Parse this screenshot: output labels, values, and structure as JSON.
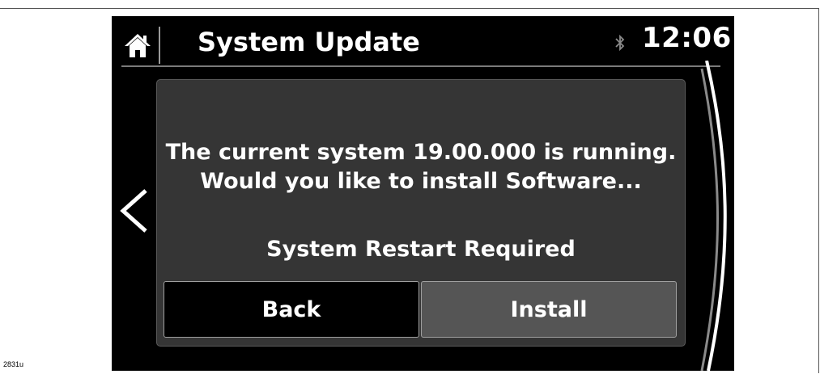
{
  "header": {
    "title": "System Update",
    "clock": "12:06",
    "home_icon": "home-icon",
    "status_icon": "bluetooth-icon"
  },
  "navigation": {
    "back_icon": "chevron-left-icon"
  },
  "dialog": {
    "message_line1": "The current system 19.00.000 is running.",
    "message_line2": "Would you like to install Software...",
    "note": "System Restart Required",
    "buttons": {
      "back_label": "Back",
      "install_label": "Install"
    }
  },
  "figure_code": "2831u",
  "colors": {
    "screen_bg": "#000000",
    "dialog_bg": "#353535",
    "install_button_bg": "#555555",
    "text": "#ffffff"
  }
}
